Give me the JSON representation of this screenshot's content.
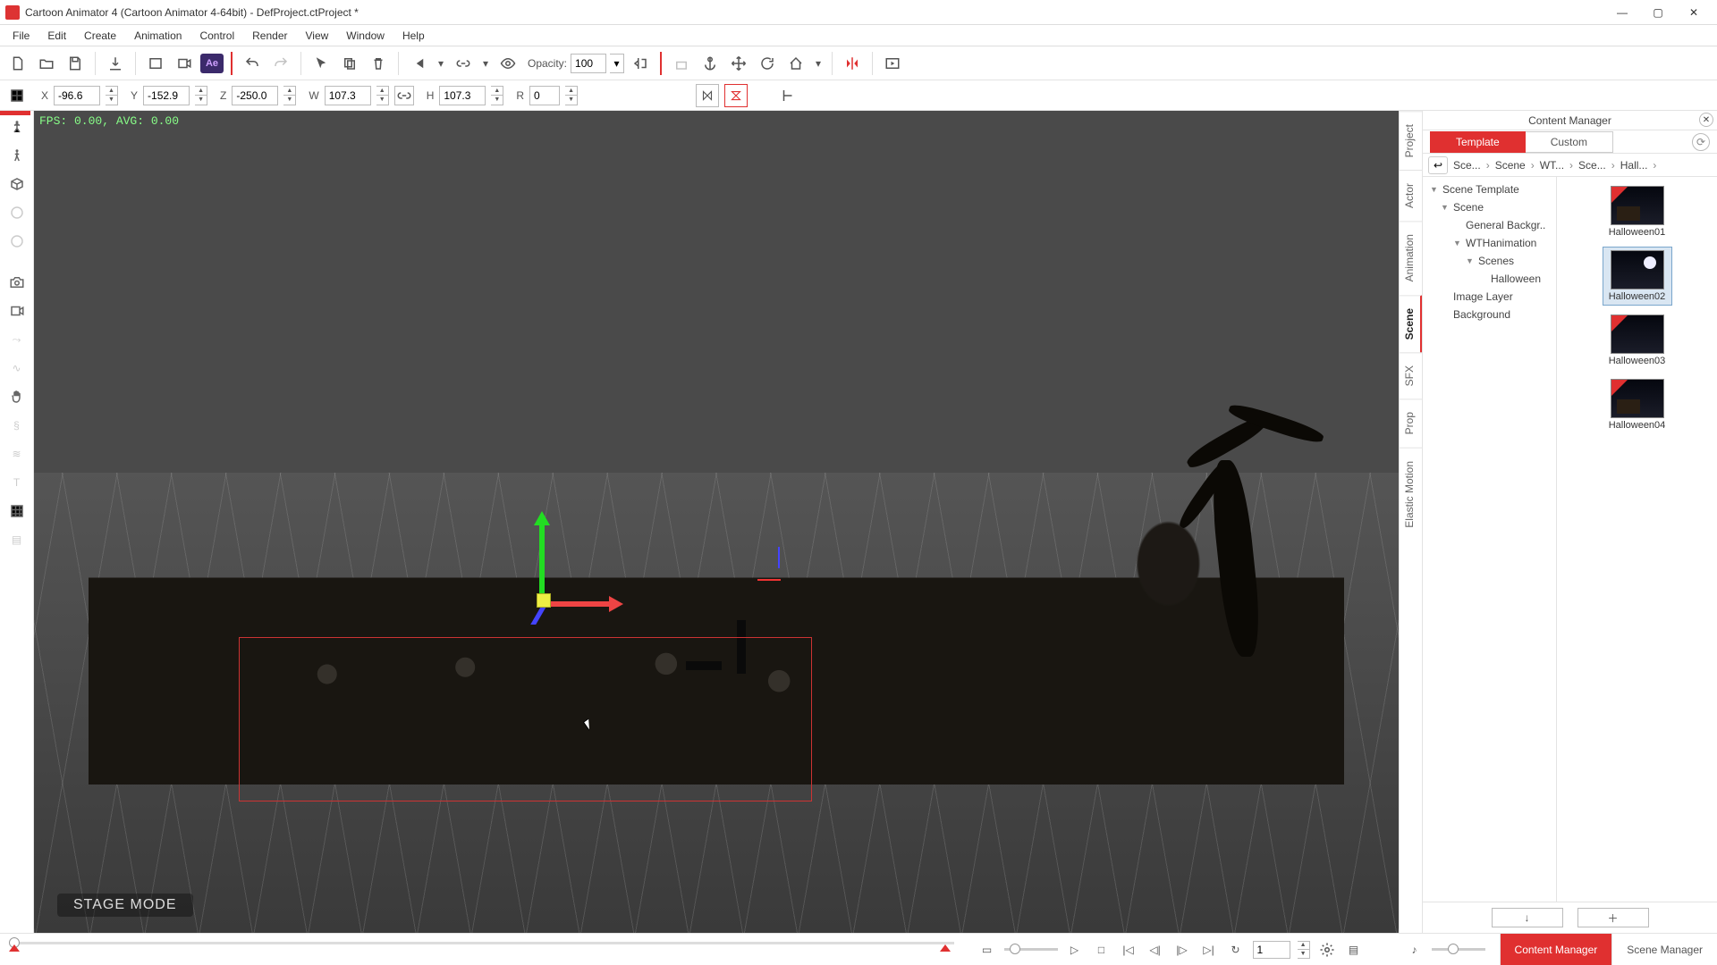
{
  "window": {
    "title": "Cartoon Animator 4   (Cartoon Animator 4-64bit) - DefProject.ctProject *"
  },
  "menu": [
    "File",
    "Edit",
    "Create",
    "Animation",
    "Control",
    "Render",
    "View",
    "Window",
    "Help"
  ],
  "toolbar": {
    "opacity_label": "Opacity:",
    "opacity_value": "100",
    "ae_label": "Ae"
  },
  "transform": {
    "x_label": "X",
    "x": "-96.6",
    "y_label": "Y",
    "y": "-152.9",
    "z_label": "Z",
    "z": "-250.0",
    "w_label": "W",
    "w": "107.3",
    "h_label": "H",
    "h": "107.3",
    "r_label": "R",
    "r": "0"
  },
  "viewport": {
    "fps": "FPS: 0.00, AVG: 0.00",
    "mode": "STAGE MODE"
  },
  "categories": [
    "Project",
    "Actor",
    "Animation",
    "Scene",
    "SFX",
    "Prop",
    "Elastic Motion"
  ],
  "active_category": "Scene",
  "content_manager": {
    "title": "Content Manager",
    "tabs": {
      "template": "Template",
      "custom": "Custom"
    },
    "breadcrumbs": [
      "Sce...",
      "Scene",
      "WT...",
      "Sce...",
      "Hall..."
    ],
    "tree": [
      {
        "label": "Scene Template",
        "depth": 0,
        "exp": true
      },
      {
        "label": "Scene",
        "depth": 1,
        "exp": true
      },
      {
        "label": "General Backgr..",
        "depth": 2,
        "exp": false
      },
      {
        "label": "WTHanimation",
        "depth": 2,
        "exp": true
      },
      {
        "label": "Scenes",
        "depth": 3,
        "exp": true
      },
      {
        "label": "Halloween",
        "depth": 4,
        "exp": false,
        "sel": false
      },
      {
        "label": "Image Layer",
        "depth": 1,
        "exp": false
      },
      {
        "label": "Background",
        "depth": 1,
        "exp": false
      }
    ],
    "thumbs": [
      {
        "label": "Halloween01",
        "badge": true,
        "moon": false,
        "house": true
      },
      {
        "label": "Halloween02",
        "badge": false,
        "moon": true,
        "house": false,
        "sel": true
      },
      {
        "label": "Halloween03",
        "badge": true,
        "moon": false,
        "house": false
      },
      {
        "label": "Halloween04",
        "badge": true,
        "moon": false,
        "house": true
      }
    ]
  },
  "playback": {
    "frame": "1"
  },
  "bottom_tabs": {
    "content": "Content Manager",
    "scene": "Scene Manager"
  }
}
